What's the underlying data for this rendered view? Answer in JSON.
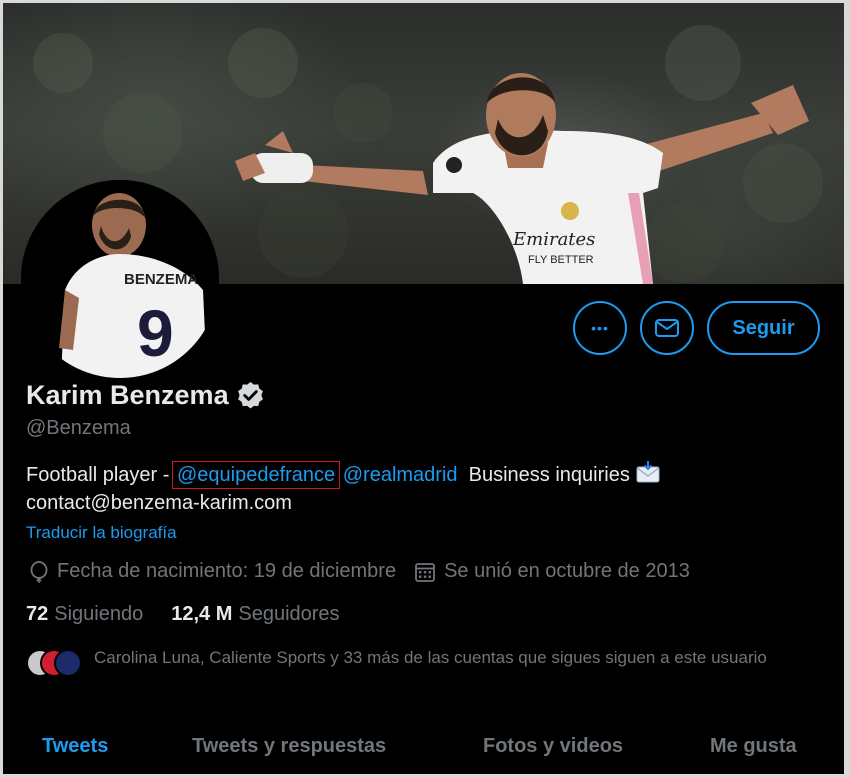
{
  "profile": {
    "name": "Karim Benzema",
    "handle": "@Benzema",
    "jersey_name": "BENZEMA",
    "jersey_number": "9",
    "shirt_sponsor": "Emirates",
    "shirt_sponsor_sub": "FLY BETTER",
    "bio": {
      "prefix": "Football player - ",
      "mention_1": "@equipedefrance",
      "mention_2": "@realmadrid",
      "text_2": "  Business inquiries ",
      "email": "contact@benzema-karim.com"
    },
    "translate_label": "Traducir la biografía",
    "birthdate": "Fecha de nacimiento: 19 de diciembre",
    "joined": "Se unió en octubre de 2013",
    "following_count": "72",
    "following_label": "Siguiendo",
    "followers_count": "12,4 M",
    "followers_label": "Seguidores",
    "known_followers": "Carolina Luna, Caliente Sports y 33 más de las cuentas que sigues siguen a este usuario"
  },
  "actions": {
    "more_label": "•••",
    "follow_label": "Seguir"
  },
  "tabs": [
    {
      "label": "Tweets",
      "active": true
    },
    {
      "label": "Tweets y respuestas",
      "active": false
    },
    {
      "label": "Fotos y videos",
      "active": false
    },
    {
      "label": "Me gusta",
      "active": false
    }
  ],
  "colors": {
    "accent": "#1d9bf0",
    "background": "#000000",
    "muted_text": "#71767b",
    "highlight_box": "#d0191f"
  },
  "icons": [
    "more-icon",
    "envelope-icon",
    "verified-badge-icon",
    "balloon-icon",
    "calendar-icon",
    "incoming-envelope-emoji"
  ]
}
